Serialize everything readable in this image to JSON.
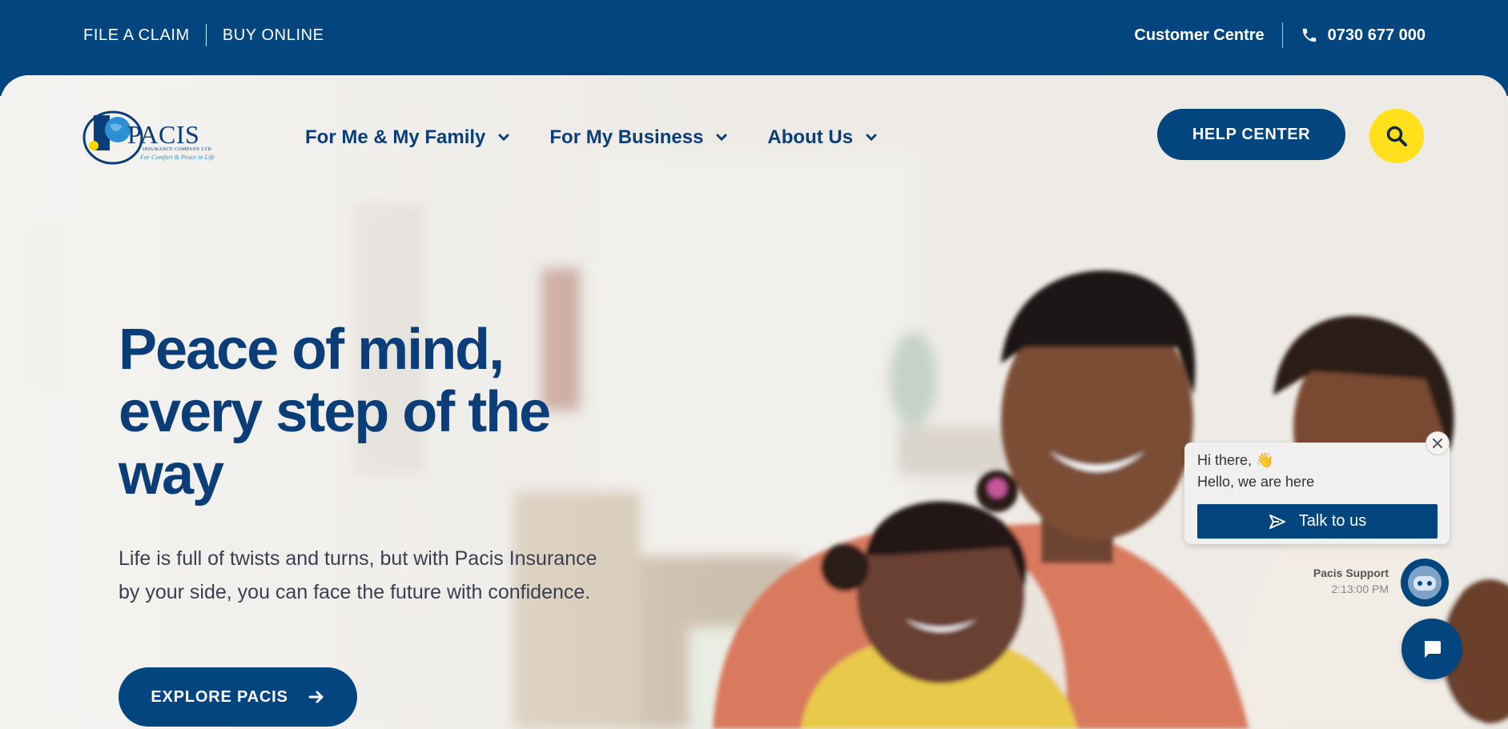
{
  "topbar": {
    "file_claim": "FILE A CLAIM",
    "buy_online": "BUY ONLINE",
    "customer_centre": "Customer Centre",
    "phone": "0730 677 000"
  },
  "logo": {
    "name": "PACIS",
    "sub": "INSURANCE COMPANY LTD",
    "tagline": "For Comfort & Peace in Life"
  },
  "nav": {
    "items": [
      {
        "label": "For Me & My Family"
      },
      {
        "label": "For My Business"
      },
      {
        "label": "About Us"
      }
    ],
    "help_center": "HELP CENTER"
  },
  "hero": {
    "headline_lines": [
      "Peace of mind,",
      "every step of the",
      "way"
    ],
    "subtext": "Life is full of twists and turns, but with Pacis Insurance by your side, you can face the future with confidence.",
    "cta": "EXPLORE PACIS"
  },
  "chat": {
    "greeting": "Hi there, 👋",
    "hello": "Hello, we are here",
    "talk_button": "Talk to us",
    "agent_name": "Pacis Support",
    "time": "2:13:00 PM"
  },
  "colors": {
    "brand_blue": "#03467f",
    "accent_yellow": "#ffe01b",
    "heading_blue": "#0b3e78"
  }
}
